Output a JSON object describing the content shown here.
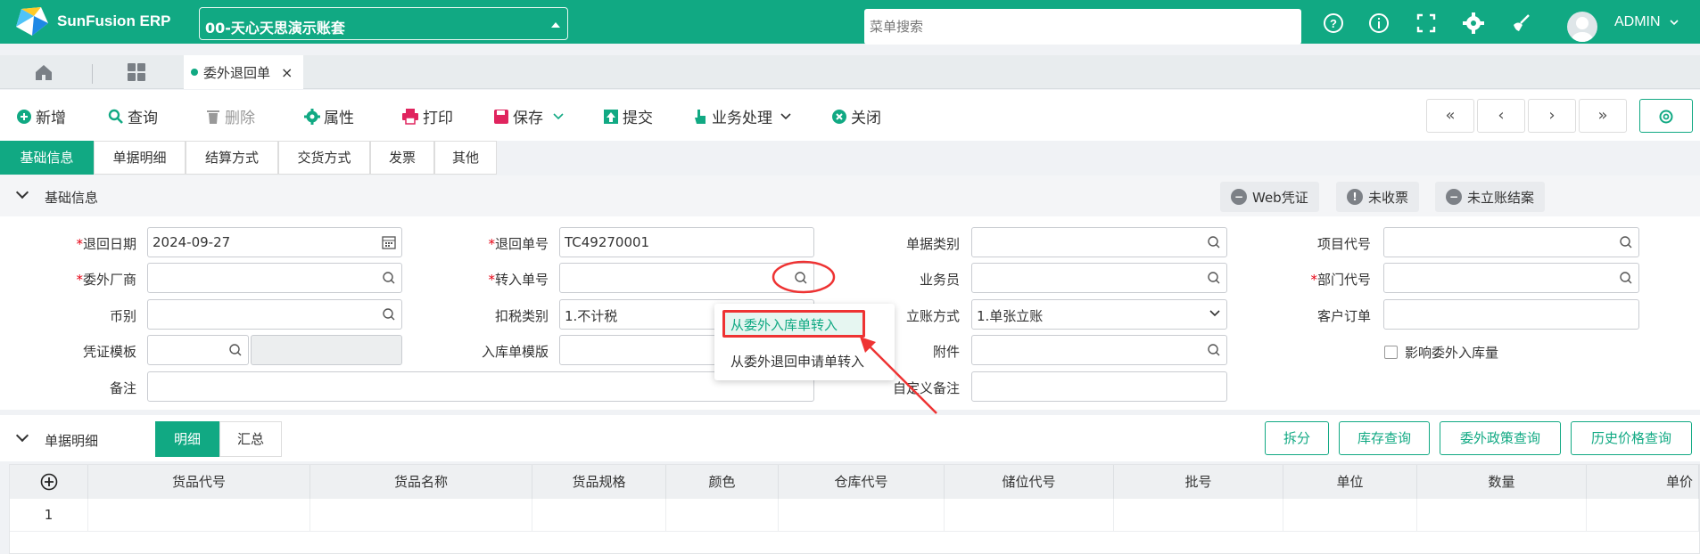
{
  "app": {
    "name": "SunFusion ERP",
    "account": "00-天心天思演示账套",
    "search_placeholder": "菜单搜索",
    "user": "ADMIN"
  },
  "tabs": {
    "doc_tab": "委外退回单"
  },
  "toolbar": {
    "new": "新增",
    "query": "查询",
    "delete": "删除",
    "properties": "属性",
    "print": "打印",
    "save": "保存",
    "submit": "提交",
    "business": "业务处理",
    "close": "关闭",
    "nav": [
      "«",
      "‹",
      "›",
      "»"
    ]
  },
  "section_tabs": [
    "基础信息",
    "单据明细",
    "结算方式",
    "交货方式",
    "发票",
    "其他"
  ],
  "basic": {
    "title": "基础信息",
    "web_voucher": "Web凭证",
    "uncollected": "未收票",
    "unsettled": "未立账结案"
  },
  "form": {
    "return_date_label": "退回日期",
    "return_date": "2024-09-27",
    "return_no_label": "退回单号",
    "return_no": "TC49270001",
    "doc_type_label": "单据类别",
    "project_label": "项目代号",
    "vendor_label": "委外厂商",
    "transfer_label": "转入单号",
    "salesman_label": "业务员",
    "dept_label": "部门代号",
    "currency_label": "币别",
    "tax_label": "扣税类别",
    "tax_value": "1.不计税",
    "account_label": "立账方式",
    "account_value": "1.单张立账",
    "cust_order_label": "客户订单",
    "voucher_tpl_label": "凭证模板",
    "instock_tpl_label": "入库单模版",
    "attach_label": "附件",
    "affect_label": "影响委外入库量",
    "remark_label": "备注",
    "custom_remark_label": "自定义备注"
  },
  "popup": {
    "item1": "从委外入库单转入",
    "item2": "从委外退回申请单转入"
  },
  "detail": {
    "title": "单据明细",
    "tab_detail": "明细",
    "tab_summary": "汇总",
    "btn_split": "拆分",
    "btn_stock": "库存查询",
    "btn_policy": "委外政策查询",
    "btn_price": "历史价格查询"
  },
  "grid": {
    "columns": [
      "货品代号",
      "货品名称",
      "货品规格",
      "颜色",
      "仓库代号",
      "储位代号",
      "批号",
      "单位",
      "数量",
      "单价"
    ],
    "rows": [
      "1"
    ]
  },
  "colors": {
    "brand": "#11a983",
    "highlight": "#e33333"
  }
}
